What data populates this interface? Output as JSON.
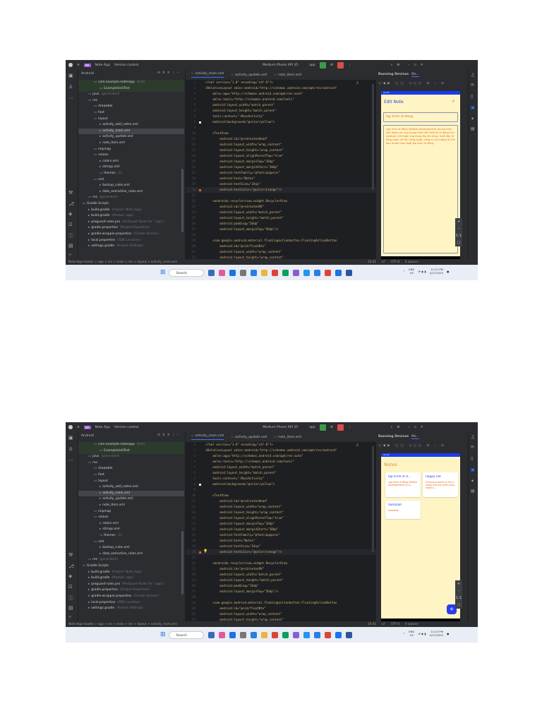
{
  "ide": {
    "project_badge": "NA",
    "project_name": "Note App",
    "vcs": "Version control",
    "device": "Medium Phone API 35",
    "run_config": "app",
    "panel_title": "Android",
    "tabs": [
      "activity_main.xml",
      "activity_update.xml",
      "note_item.xml"
    ],
    "warnings": "2",
    "tree": [
      {
        "label": "com.example.notesapp",
        "hint": "(test)",
        "indent": 1,
        "highlight": true
      },
      {
        "label": "ExampleUnitTest",
        "hint": "",
        "indent": 2,
        "highlight": true
      },
      {
        "label": "java",
        "hint": "(generated)",
        "indent": 0
      },
      {
        "label": "res",
        "hint": "",
        "indent": 0
      },
      {
        "label": "drawable",
        "hint": "",
        "indent": 1
      },
      {
        "label": "font",
        "hint": "",
        "indent": 1
      },
      {
        "label": "layout",
        "hint": "",
        "indent": 1
      },
      {
        "label": "activity_add_notes.xml",
        "hint": "",
        "indent": 2
      },
      {
        "label": "activity_main.xml",
        "hint": "",
        "indent": 2,
        "selected": true
      },
      {
        "label": "activity_update.xml",
        "hint": "",
        "indent": 2
      },
      {
        "label": "note_item.xml",
        "hint": "",
        "indent": 2
      },
      {
        "label": "mipmap",
        "hint": "",
        "indent": 1
      },
      {
        "label": "values",
        "hint": "",
        "indent": 1
      },
      {
        "label": "colors.xml",
        "hint": "",
        "indent": 2
      },
      {
        "label": "strings.xml",
        "hint": "",
        "indent": 2
      },
      {
        "label": "themes",
        "hint": "(2)",
        "indent": 2
      },
      {
        "label": "xml",
        "hint": "",
        "indent": 1
      },
      {
        "label": "backup_rules.xml",
        "hint": "",
        "indent": 2
      },
      {
        "label": "data_extraction_rules.xml",
        "hint": "",
        "indent": 2
      },
      {
        "label": "res",
        "hint": "(generated)",
        "indent": 0
      },
      {
        "label": "Gradle Scripts",
        "hint": "",
        "indent": -1
      },
      {
        "label": "build.gradle",
        "hint": "(Project: Note_App)",
        "indent": 0
      },
      {
        "label": "build.gradle",
        "hint": "(Module :app)",
        "indent": 0
      },
      {
        "label": "proguard-rules.pro",
        "hint": "(ProGuard Rules for \":app\")",
        "indent": 0
      },
      {
        "label": "gradle.properties",
        "hint": "(Project Properties)",
        "indent": 0
      },
      {
        "label": "gradle-wrapper.properties",
        "hint": "(Gradle Version)",
        "indent": 0
      },
      {
        "label": "local.properties",
        "hint": "(SDK Location)",
        "indent": 0
      },
      {
        "label": "settings.gradle",
        "hint": "(Project Settings)",
        "indent": 0
      }
    ],
    "code": [
      "<?xml version=\"1.0\" encoding=\"utf-8\"?>",
      "<RelativeLayout xmlns:android=\"http://schemas.android.com/apk/res/android\"",
      "    xmlns:app=\"http://schemas.android.com/apk/res-auto\"",
      "    xmlns:tools=\"http://schemas.android.com/tools\"",
      "    android:layout_width=\"match_parent\"",
      "    android:layout_height=\"match_parent\"",
      "    tools:context=\".MainActivity\"",
      "    android:background=\"@color/yellow\">",
      "",
      "    <TextView",
      "        android:id=\"@+id/notesHead\"",
      "        android:layout_width=\"wrap_content\"",
      "        android:layout_height=\"wrap_content\"",
      "        android:layout_alignParentTop=\"true\"",
      "        android:layout_marginTop=\"16dp\"",
      "        android:layout_marginStart=\"10dp\"",
      "        android:fontFamily=\"@font/poppins\"",
      "        android:text=\"Notes\"",
      "        android:textSize=\"24sp\"",
      "        android:textColor=\"@color/orange\"/>",
      "",
      "    <androidx.recyclerview.widget.RecyclerView",
      "        android:id=\"@+id/notesRV\"",
      "        android:layout_width=\"match_parent\"",
      "        android:layout_height=\"match_parent\"",
      "        android:padding=\"16dp\"",
      "        android:layout_marginTop=\"56dp\"/>",
      "",
      "    <com.google.android.material.floatingactionbutton.FloatingActionButton",
      "        android:id=\"@+id/floatBtn\"",
      "        android:layout_width=\"wrap_content\"",
      "        android:layout_height=\"wrap_content\""
    ],
    "running_devices": "Running Devices",
    "device_tab": "Me...",
    "breadcrumb": "Note-App-master > app > src > main > res > layout > activity_main.xml",
    "status": {
      "position": "20:41",
      "line_sep": "LF",
      "encoding": "UTF-8",
      "indent": "4 spaces"
    },
    "taskbar": {
      "search": "Search",
      "lang": "ENG",
      "region": "US",
      "date": "2/27/2025"
    },
    "colors": {
      "accent": "#3574f0",
      "phone_bg": "#fff5c4",
      "orange": "#e06b1d",
      "blue": "#2a3cf0"
    }
  },
  "screenshots": [
    {
      "time": "11:21 PM",
      "phone_time": "11:21",
      "screen": "edit",
      "edit": {
        "title": "Edit Note",
        "note_title": "lap trinh di dong",
        "note_body": "Lập trình di động (Mobile Development) là quá trình xây dựng các ứng dụng chạy trên thiết bị di động như Android, iOS hoặc ứng dụng đa nền tảng. Dưới đây là tổng quan về các công nghệ, công cụ và hướng đi nếu bạn muốn theo đuổi lập trình di động."
      }
    },
    {
      "time": "11:22 PM",
      "phone_time": "11:22",
      "screen": "list",
      "list": {
        "title": "Notes",
        "cards": [
          {
            "title": "lap trinh di d...",
            "body": "Lập trình di động (Mobile Development) là q..."
          },
          {
            "title": "happy life",
            "body": "Everyone wants to live a happy life but when busy make u..."
          },
          {
            "title": "hahahah",
            "body": "lololololo"
          }
        ]
      }
    }
  ]
}
